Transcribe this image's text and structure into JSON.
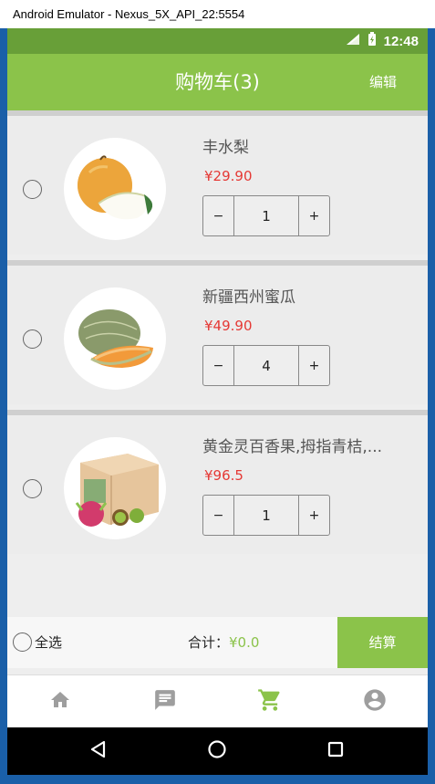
{
  "window": {
    "title": "Android Emulator - Nexus_5X_API_22:5554"
  },
  "status_bar": {
    "time": "12:48"
  },
  "app_bar": {
    "title": "购物车(3)",
    "edit_label": "编辑"
  },
  "cart_items": [
    {
      "name": "丰水梨",
      "price": "¥29.90",
      "quantity": "1",
      "image": "asian-pear"
    },
    {
      "name": "新疆西州蜜瓜",
      "price": "¥49.90",
      "quantity": "4",
      "image": "hami-melon"
    },
    {
      "name": "黄金灵百香果,拇指青桔,...",
      "price": "¥96.5",
      "quantity": "1",
      "image": "fruit-gift-box"
    }
  ],
  "stepper": {
    "minus": "−",
    "plus": "+"
  },
  "footer": {
    "select_all_label": "全选",
    "total_label": "合计：",
    "total_amount": "¥0.0",
    "checkout_label": "结算"
  },
  "tabs": [
    {
      "name": "home",
      "icon": "home-icon",
      "active": false
    },
    {
      "name": "messages",
      "icon": "message-icon",
      "active": false
    },
    {
      "name": "cart",
      "icon": "cart-icon",
      "active": true
    },
    {
      "name": "profile",
      "icon": "account-circle-icon",
      "active": false
    }
  ],
  "colors": {
    "primary": "#8bc34a",
    "primary_dark": "#689f38",
    "price": "#e53935",
    "tab_inactive": "#9e9e9e"
  }
}
